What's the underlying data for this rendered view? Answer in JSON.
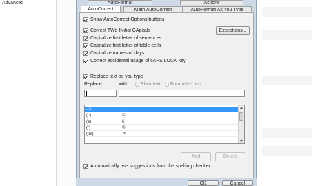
{
  "background": {
    "sidebar_item": "Advanced"
  },
  "tabs": {
    "row1": [
      "AutoFormat",
      "Actions"
    ],
    "row2": [
      "AutoCorrect",
      "Math AutoCorrect",
      "AutoFormat As You Type"
    ]
  },
  "options": {
    "show_buttons": "Show AutoCorrect Options buttons",
    "two_initial": "Correct TWo INitial CApitals",
    "first_sentence": "Capitalize first letter of sentences",
    "first_table": "Capitalize first letter of table cells",
    "days": "Capitalize names of days",
    "caps_lock": "Correct accidental usage of cAPS LOCK key"
  },
  "exceptions_label": "Exceptions...",
  "replace_as_type": "Replace text as you type",
  "replace_label": "Replace:",
  "with_label": "With:",
  "plain_text": "Plain text",
  "formatted_text": "Formatted text",
  "replace_value": "",
  "with_value": "",
  "table": {
    "rows": [
      {
        "from": "-->",
        "to": "→",
        "selected": true
      },
      {
        "from": "(c)",
        "to": "©"
      },
      {
        "from": "(e)",
        "to": "€"
      },
      {
        "from": "(r)",
        "to": "®"
      },
      {
        "from": "(tm)",
        "to": "™"
      },
      {
        "from": "...",
        "to": "…"
      }
    ]
  },
  "buttons": {
    "add": "Add",
    "delete": "Delete",
    "ok": "OK",
    "cancel": "Cancel"
  },
  "auto_suggest": "Automatically use suggestions from the spelling checker",
  "colors": {
    "dialog_frame": "#ced9e6",
    "selection": "#3399ff"
  }
}
